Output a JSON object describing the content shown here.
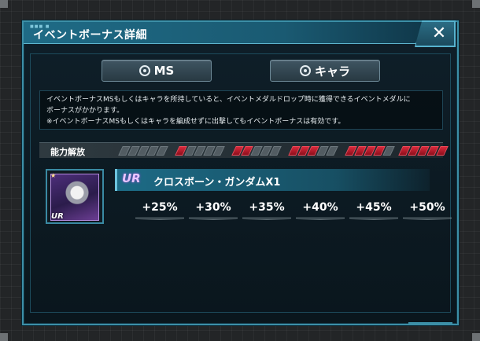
{
  "dialog": {
    "title": "イベントボーナス詳細",
    "header_dots": "■■■ ■",
    "close_label": "✕"
  },
  "tabs": [
    {
      "label": "MS",
      "icon": "target-icon"
    },
    {
      "label": "キャラ",
      "icon": "target-icon"
    }
  ],
  "description": {
    "line1": "イベントボーナスMSもしくはキャラを所持していると、イベントメダルドロップ時に獲得できるイベントメダルに",
    "line2": "ボーナスがかかります。",
    "line3": "※イベントボーナスMSもしくはキャラを編成せずに出撃してもイベントボーナスは有効です。"
  },
  "ability": {
    "label": "能力解放",
    "levels": [
      0,
      1,
      2,
      3,
      4,
      5
    ],
    "segments_per_meter": 5,
    "active_color": "#d9283a",
    "inactive_color": "#525c62"
  },
  "unit": {
    "rarity": "UR",
    "name": "クロスボーン・ガンダムX1",
    "portrait_rarity": "UR",
    "portrait_star": "★",
    "bonuses": [
      "+25%",
      "+30%",
      "+35%",
      "+40%",
      "+45%",
      "+50%"
    ]
  },
  "colors": {
    "accent": "#3c8fa7",
    "header": "#1f6b86",
    "red_segment": "#d9283a"
  }
}
